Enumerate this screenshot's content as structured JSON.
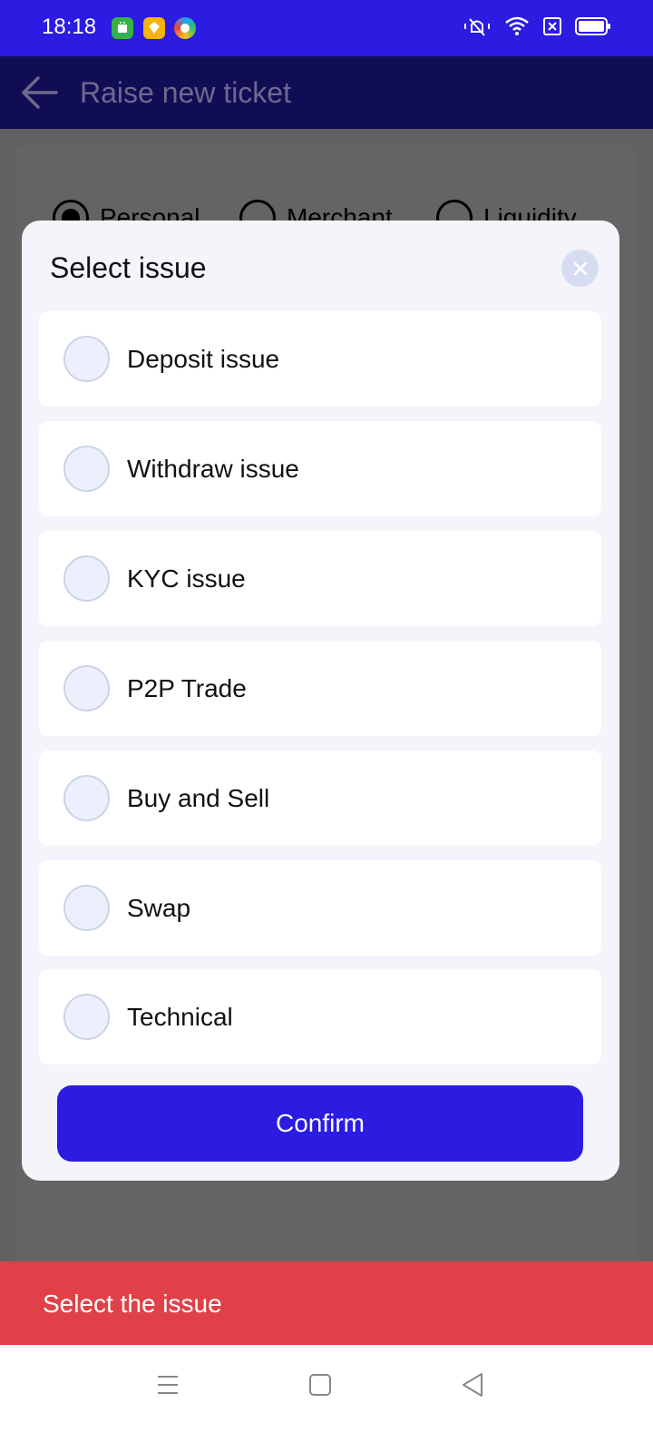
{
  "status_bar": {
    "time": "18:18",
    "app_icons": [
      "android-app-icon",
      "sketch-app-icon",
      "edge-browser-icon"
    ],
    "system_icons": [
      "vibrate-mute-icon",
      "wifi-icon",
      "no-sim-icon",
      "battery-icon"
    ],
    "background_color": "#2c1be0"
  },
  "app_bar": {
    "title": "Raise new ticket"
  },
  "account_types": [
    {
      "label": "Personal",
      "selected": true
    },
    {
      "label": "Merchant",
      "selected": false
    },
    {
      "label": "Liquidity",
      "selected": false
    }
  ],
  "modal": {
    "title": "Select issue",
    "issues": [
      {
        "label": "Deposit issue",
        "selected": false
      },
      {
        "label": "Withdraw issue",
        "selected": false
      },
      {
        "label": "KYC issue",
        "selected": false
      },
      {
        "label": "P2P Trade",
        "selected": false
      },
      {
        "label": "Buy and Sell",
        "selected": false
      },
      {
        "label": "Swap",
        "selected": false
      },
      {
        "label": "Technical",
        "selected": false
      }
    ],
    "confirm_label": "Confirm"
  },
  "snackbar": {
    "message": "Select the issue",
    "color": "#e04148"
  },
  "colors": {
    "primary": "#2c1be0",
    "app_bar_dim": "#110d55",
    "overlay": "#616161"
  },
  "nav_bar": {
    "buttons": [
      "menu-icon",
      "home-icon",
      "back-triangle-icon"
    ]
  }
}
